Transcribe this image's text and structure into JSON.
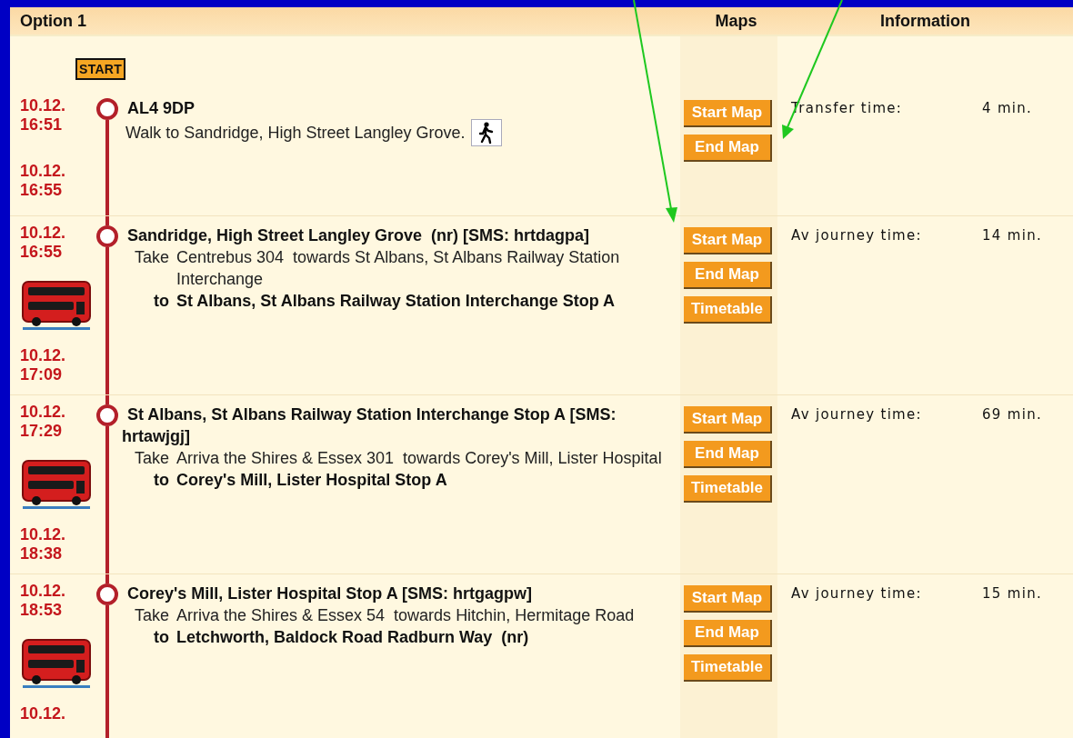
{
  "header": {
    "title": "Option 1",
    "maps": "Maps",
    "information": "Information"
  },
  "start_badge": "START",
  "legs": [
    {
      "kind": "walk",
      "dep_date": "10.12.",
      "dep_time": "16:51",
      "stop": "AL4 9DP",
      "description": "Walk to Sandridge, High Street Langley Grove.",
      "arr_date": "10.12.",
      "arr_time": "16:55",
      "buttons": [
        "Start Map",
        "End Map"
      ],
      "info_label": "Transfer time:",
      "info_value": "4 min."
    },
    {
      "kind": "bus",
      "dep_date": "10.12.",
      "dep_time": "16:55",
      "stop": "Sandridge, High Street Langley Grove  (nr) [SMS: hrtdagpa]",
      "take_label": "Take",
      "service": "Centrebus 304  towards St Albans, St Albans Railway Station Interchange",
      "to_label": "to",
      "destination": "St Albans, St Albans Railway Station Interchange Stop A",
      "arr_date": "10.12.",
      "arr_time": "17:09",
      "buttons": [
        "Start Map",
        "End Map",
        "Timetable"
      ],
      "info_label": "Av journey time:",
      "info_value": "14 min."
    },
    {
      "kind": "bus",
      "dep_date": "10.12.",
      "dep_time": "17:29",
      "stop": "St Albans, St Albans Railway Station Interchange Stop A [SMS: hrtawjgj]",
      "take_label": "Take",
      "service": "Arriva the Shires & Essex 301  towards Corey's Mill, Lister Hospital",
      "to_label": "to",
      "destination": "Corey's Mill, Lister Hospital Stop A",
      "arr_date": "10.12.",
      "arr_time": "18:38",
      "buttons": [
        "Start Map",
        "End Map",
        "Timetable"
      ],
      "info_label": "Av journey time:",
      "info_value": "69 min."
    },
    {
      "kind": "bus",
      "dep_date": "10.12.",
      "dep_time": "18:53",
      "stop": "Corey's Mill, Lister Hospital Stop A [SMS: hrtgagpw]",
      "take_label": "Take",
      "service": "Arriva the Shires & Essex 54  towards Hitchin, Hermitage Road",
      "to_label": "to",
      "destination": "Letchworth, Baldock Road Radburn Way  (nr)",
      "arr_date": "10.12.",
      "buttons": [
        "Start Map",
        "End Map",
        "Timetable"
      ],
      "info_label": "Av journey time:",
      "info_value": "15 min."
    }
  ]
}
